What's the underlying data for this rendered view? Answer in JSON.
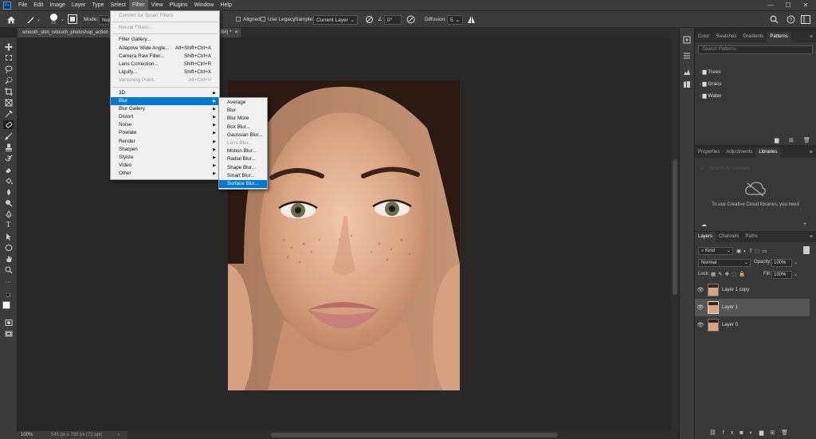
{
  "menubar": {
    "items": [
      "File",
      "Edit",
      "Image",
      "Layer",
      "Type",
      "Select",
      "Filter",
      "View",
      "Plugins",
      "Window",
      "Help"
    ],
    "active_index": 6,
    "logo": "Ps"
  },
  "options_bar": {
    "mode_label": "Mode:",
    "mode_value": "Nor",
    "brush_size": "23",
    "aligned_label": "Aligned",
    "use_legacy_label": "Use Legacy",
    "sample_label": "Sample:",
    "sample_value": "Current Layer",
    "angle_value": "0°",
    "diffusion_label": "Diffusion:",
    "diffusion_value": "5"
  },
  "document_tab": {
    "title": "smooth_skin_retouch_photoshop_action",
    "suffix": "/8#) *"
  },
  "filter_menu": {
    "items": [
      {
        "label": "Convert for Smart Filters",
        "disabled": true
      },
      {
        "sep": true
      },
      {
        "label": "Neural Filters...",
        "disabled": true
      },
      {
        "sep": true
      },
      {
        "label": "Filter Gallery..."
      },
      {
        "label": "Adaptive Wide Angle...",
        "shortcut": "Alt+Shift+Ctrl+A"
      },
      {
        "label": "Camera Raw Filter...",
        "shortcut": "Shift+Ctrl+A"
      },
      {
        "label": "Lens Correction...",
        "shortcut": "Shift+Ctrl+R"
      },
      {
        "label": "Liquify...",
        "shortcut": "Shift+Ctrl+X"
      },
      {
        "label": "Vanishing Point...",
        "shortcut": "Alt+Ctrl+V",
        "disabled": true
      },
      {
        "sep": true
      },
      {
        "label": "3D",
        "submenu": true
      },
      {
        "label": "Blur",
        "submenu": true,
        "highlighted": true
      },
      {
        "label": "Blur Gallery",
        "submenu": true
      },
      {
        "label": "Distort",
        "submenu": true
      },
      {
        "label": "Noise",
        "submenu": true
      },
      {
        "label": "Pixelate",
        "submenu": true
      },
      {
        "label": "Render",
        "submenu": true
      },
      {
        "label": "Sharpen",
        "submenu": true
      },
      {
        "label": "Stylize",
        "submenu": true
      },
      {
        "label": "Video",
        "submenu": true
      },
      {
        "label": "Other",
        "submenu": true
      }
    ]
  },
  "blur_submenu": {
    "items": [
      {
        "label": "Average"
      },
      {
        "label": "Blur"
      },
      {
        "label": "Blur More"
      },
      {
        "label": "Box Blur..."
      },
      {
        "label": "Gaussian Blur..."
      },
      {
        "label": "Lens Blur...",
        "disabled": true
      },
      {
        "label": "Motion Blur..."
      },
      {
        "label": "Radial Blur..."
      },
      {
        "label": "Shape Blur..."
      },
      {
        "label": "Smart Blur..."
      },
      {
        "label": "Surface Blur...",
        "highlighted": true
      }
    ]
  },
  "patterns_panel": {
    "tabs": [
      "Color",
      "Swatches",
      "Gradients",
      "Patterns"
    ],
    "active_tab": 3,
    "search_placeholder": "Search Patterns",
    "folders": [
      "Trees",
      "Grass",
      "Water"
    ]
  },
  "libraries_panel": {
    "tabs": [
      "Properties",
      "Adjustments",
      "Libraries"
    ],
    "active_tab": 2,
    "search_placeholder": "Search All Libraries",
    "message": "To use Creative Cloud libraries, you need"
  },
  "layers_panel": {
    "tabs": [
      "Layers",
      "Channels",
      "Paths"
    ],
    "active_tab": 0,
    "kind_label": "Kind",
    "blend_mode": "Normal",
    "opacity_label": "Opacity:",
    "opacity_value": "100%",
    "lock_label": "Lock:",
    "fill_label": "Fill:",
    "fill_value": "100%",
    "layers": [
      {
        "name": "Layer 1 copy",
        "selected": false
      },
      {
        "name": "Layer 1",
        "selected": true
      },
      {
        "name": "Layer 0",
        "selected": false
      }
    ]
  },
  "status_bar": {
    "zoom": "100%",
    "doc_info": "545 px x 730 px (72 ppi)"
  },
  "colors": {
    "accent": "#0078d7",
    "ui_bg": "#3b3b3b",
    "canvas_bg": "#282828"
  }
}
